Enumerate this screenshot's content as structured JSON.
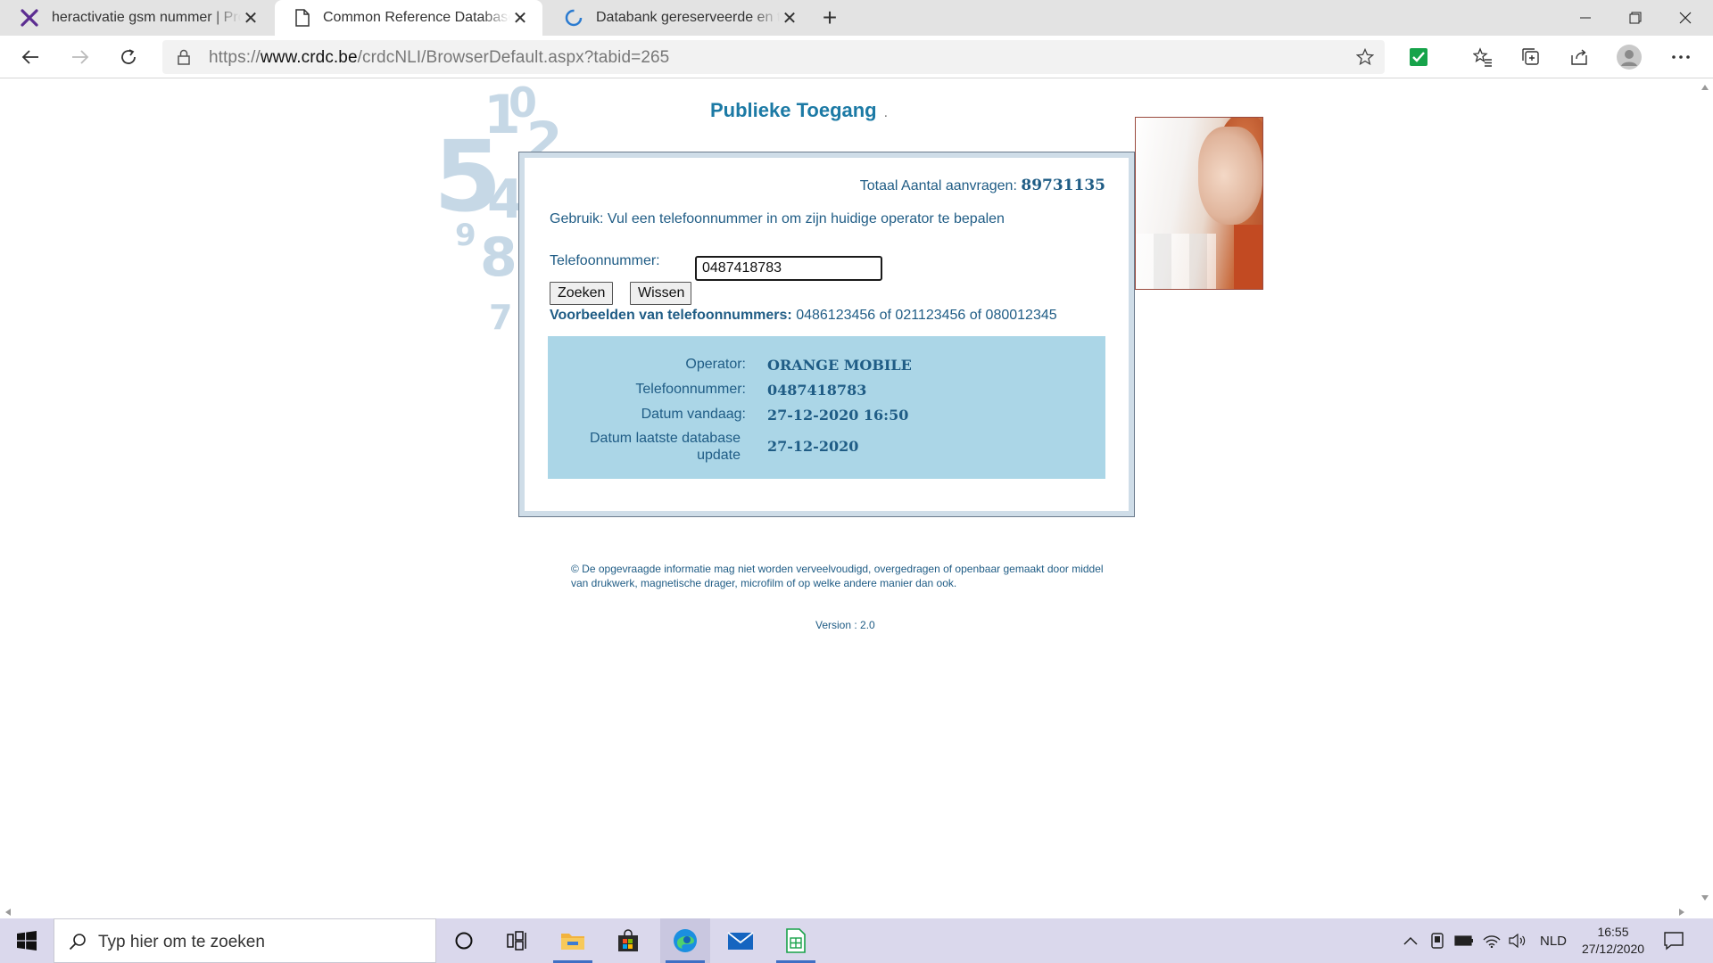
{
  "browser": {
    "tabs": [
      {
        "title": "heractivatie gsm nummer | Proximus",
        "active": false,
        "icon": "proximus-logo-icon"
      },
      {
        "title": "Common Reference Database Central",
        "active": true,
        "icon": "page-icon"
      },
      {
        "title": "Databank gereserveerde en toegekende",
        "active": false,
        "icon": "loading-icon"
      }
    ],
    "new_tab_label": "+",
    "address": {
      "scheme": "https://",
      "host": "www.crdc.be",
      "path": "/crdcNLI/BrowserDefault.aspx?tabid=265"
    }
  },
  "page": {
    "title": "Publieke Toegang",
    "title_dot": ".",
    "total_label": "Totaal Aantal aanvragen:",
    "total_value": "89731135",
    "usage_text": "Gebruik: Vul een telefoonnummer in om zijn huidige operator te bepalen",
    "phone_label": "Telefoonnummer:",
    "phone_value": "0487418783",
    "search_button": "Zoeken",
    "clear_button": "Wissen",
    "examples_label": "Voorbeelden van telefoonnummers:",
    "examples_value": "0486123456 of 021123456 of 080012345",
    "result": {
      "operator_label": "Operator:",
      "operator_value": "ORANGE MOBILE",
      "phone_label": "Telefoonnummer:",
      "phone_value": "0487418783",
      "today_label": "Datum vandaag:",
      "today_value": "27-12-2020 16:50",
      "update_label": "Datum laatste database update",
      "update_value": "27-12-2020"
    },
    "copyright": "© De opgevraagde informatie mag niet worden verveelvoudigd, overgedragen of openbaar gemaakt door middel van drukwerk, magnetische drager, microfilm of op welke andere manier dan ook.",
    "version": "Version : 2.0"
  },
  "taskbar": {
    "search_placeholder": "Typ hier om te zoeken",
    "language": "NLD",
    "time": "16:55",
    "date": "27/12/2020"
  },
  "colors": {
    "brand_blue": "#1c7aa5",
    "text_blue": "#1f5c85",
    "result_bg": "#abd6e7"
  }
}
